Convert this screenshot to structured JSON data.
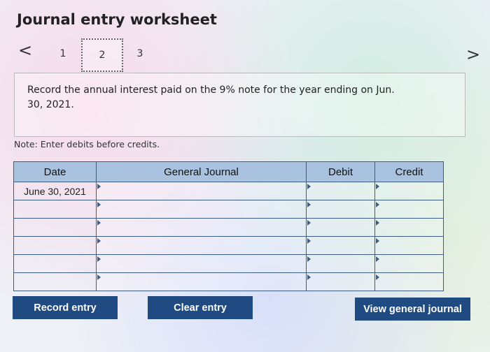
{
  "title": "Journal entry worksheet",
  "nav": {
    "prev_icon": "<",
    "next_icon": ">"
  },
  "tabs": [
    {
      "label": "1"
    },
    {
      "label": "2"
    },
    {
      "label": "3"
    }
  ],
  "active_tab": 2,
  "instruction": "Record the annual interest paid on the 9% note for the year ending on Jun. 30, 2021.",
  "note": "Note: Enter debits before credits.",
  "table": {
    "headers": [
      "Date",
      "General Journal",
      "Debit",
      "Credit"
    ],
    "rows": [
      {
        "date": "June 30, 2021",
        "account": "",
        "debit": "",
        "credit": ""
      },
      {
        "date": "",
        "account": "",
        "debit": "",
        "credit": ""
      },
      {
        "date": "",
        "account": "",
        "debit": "",
        "credit": ""
      },
      {
        "date": "",
        "account": "",
        "debit": "",
        "credit": ""
      },
      {
        "date": "",
        "account": "",
        "debit": "",
        "credit": ""
      },
      {
        "date": "",
        "account": "",
        "debit": "",
        "credit": ""
      }
    ]
  },
  "buttons": {
    "record": "Record entry",
    "clear": "Clear entry",
    "view": "View general journal"
  },
  "colors": {
    "button": "#1f4a82",
    "header": "#a9c2df",
    "border": "#3d5c84"
  }
}
